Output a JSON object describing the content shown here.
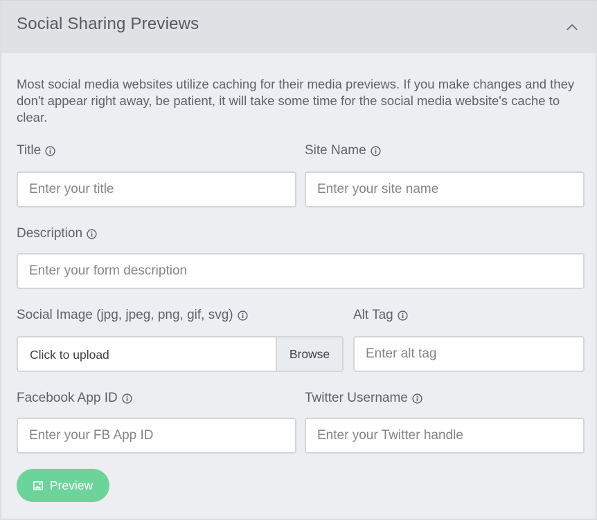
{
  "header": {
    "title": "Social Sharing Previews",
    "collapse_icon": "chevron-up-icon"
  },
  "intro_text": "Most social media websites utilize caching for their media previews. If you make changes and they don't appear right away, be patient, it will take some time for the social media website's cache to clear.",
  "fields": {
    "title": {
      "label": "Title",
      "placeholder": "Enter your title",
      "value": ""
    },
    "site_name": {
      "label": "Site Name",
      "placeholder": "Enter your site name",
      "value": ""
    },
    "description": {
      "label": "Description",
      "placeholder": "Enter your form description",
      "value": ""
    },
    "social_image": {
      "label": "Social Image (jpg, jpeg, png, gif, svg)",
      "upload_text": "Click to upload",
      "browse_label": "Browse"
    },
    "alt_tag": {
      "label": "Alt Tag",
      "placeholder": "Enter alt tag",
      "value": ""
    },
    "facebook_app_id": {
      "label": "Facebook App ID",
      "placeholder": "Enter your FB App ID",
      "value": ""
    },
    "twitter_username": {
      "label": "Twitter Username",
      "placeholder": "Enter your Twitter handle",
      "value": ""
    }
  },
  "preview_button": {
    "label": "Preview",
    "icon": "image-icon"
  },
  "colors": {
    "panel_bg": "#eceef1",
    "header_bg": "#dfe1e4",
    "text": "#5d636a",
    "input_border": "#d3d5d9",
    "accent_green": "#6cd49a"
  }
}
